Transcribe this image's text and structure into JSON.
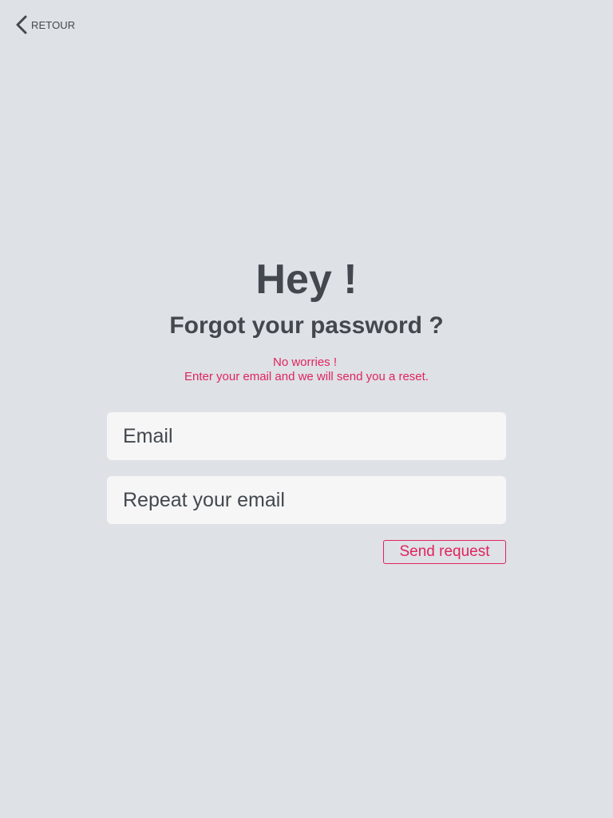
{
  "nav": {
    "back_label": "RETOUR",
    "back_icon": "chevron-left-icon"
  },
  "header": {
    "title": "Hey !",
    "subtitle": "Forgot your password ?"
  },
  "message": {
    "line1": "No worries !",
    "line2": "Enter your email and we will send you a reset."
  },
  "form": {
    "email_placeholder": "Email",
    "email_value": "",
    "repeat_placeholder": "Repeat your email",
    "repeat_value": "",
    "submit_label": "Send request"
  },
  "colors": {
    "background": "#dee1e6",
    "text": "#43484f",
    "accent": "#e0245e",
    "field_background": "#f6f6f6"
  }
}
